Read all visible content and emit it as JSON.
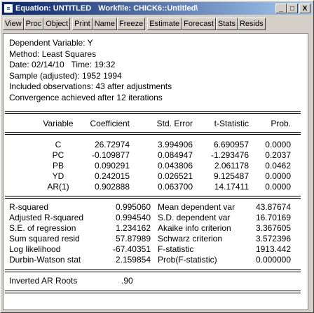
{
  "window": {
    "title_left": "Equation: UNTITLED",
    "title_right": "Workfile: CHICK6::Untitled\\",
    "controls": {
      "minimize": "_",
      "maximize": "□",
      "close": "X"
    }
  },
  "toolbar": [
    "View",
    "Proc",
    "Object",
    "Print",
    "Name",
    "Freeze",
    "Estimate",
    "Forecast",
    "Stats",
    "Resids"
  ],
  "header": {
    "dep_var": "Dependent Variable: Y",
    "method": "Method: Least Squares",
    "date": "Date: 02/14/10   Time: 19:32",
    "sample": "Sample (adjusted): 1952 1994",
    "obs": "Included observations: 43 after adjustments",
    "convergence": "Convergence achieved after 12 iterations"
  },
  "coef_table": {
    "headers": [
      "Variable",
      "Coefficient",
      "Std. Error",
      "t-Statistic",
      "Prob."
    ],
    "rows": [
      [
        "C",
        "26.72974",
        "3.994906",
        "6.690957",
        "0.0000"
      ],
      [
        "PC",
        "-0.109877",
        "0.084947",
        "-1.293476",
        "0.2037"
      ],
      [
        "PB",
        "0.090291",
        "0.043806",
        "2.061178",
        "0.0462"
      ],
      [
        "YD",
        "0.242015",
        "0.026521",
        "9.125487",
        "0.0000"
      ],
      [
        "AR(1)",
        "0.902888",
        "0.063700",
        "14.17411",
        "0.0000"
      ]
    ]
  },
  "stats": {
    "rows": [
      [
        "R-squared",
        "0.995060",
        "Mean dependent var",
        "43.87674"
      ],
      [
        "Adjusted R-squared",
        "0.994540",
        "S.D. dependent var",
        "16.70169"
      ],
      [
        "S.E. of regression",
        "1.234162",
        "Akaike info criterion",
        "3.367605"
      ],
      [
        "Sum squared resid",
        "57.87989",
        "Schwarz criterion",
        "3.572396"
      ],
      [
        "Log likelihood",
        "-67.40351",
        "F-statistic",
        "1913.442"
      ],
      [
        "Durbin-Watson stat",
        "2.159854",
        "Prob(F-statistic)",
        "0.000000"
      ]
    ]
  },
  "ar_roots": {
    "label": "Inverted AR Roots",
    "value": ".90"
  }
}
